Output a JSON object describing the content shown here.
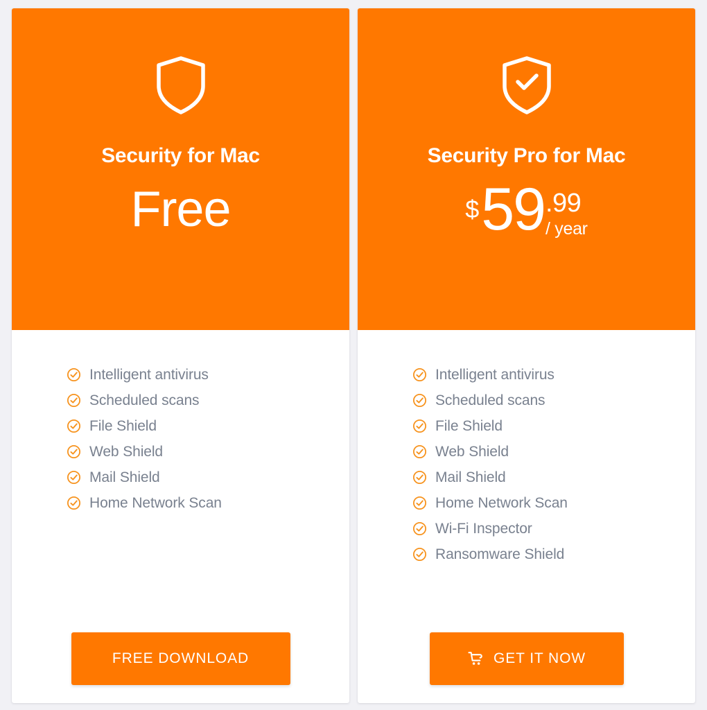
{
  "theme": {
    "accent": "#ff7800",
    "page_background": "#f1f1f5",
    "card_background": "#ffffff",
    "feature_text_color": "#79818f",
    "header_text_color": "#ffffff"
  },
  "cards": [
    {
      "id": "security-for-mac",
      "icon": "shield-icon",
      "title": "Security for Mac",
      "price": {
        "type": "free",
        "free_label": "Free",
        "currency": "",
        "amount": "",
        "cents": "",
        "period": ""
      },
      "features": [
        "Intelligent antivirus",
        "Scheduled scans",
        "File Shield",
        "Web Shield",
        "Mail Shield",
        "Home Network Scan"
      ],
      "cta": {
        "label": "FREE DOWNLOAD",
        "icon": ""
      }
    },
    {
      "id": "security-pro-for-mac",
      "icon": "shield-check-icon",
      "title": "Security Pro for Mac",
      "price": {
        "type": "paid",
        "free_label": "",
        "currency": "$",
        "amount": "59",
        "cents": ".99",
        "period": "/ year"
      },
      "features": [
        "Intelligent antivirus",
        "Scheduled scans",
        "File Shield",
        "Web Shield",
        "Mail Shield",
        "Home Network Scan",
        "Wi-Fi Inspector",
        "Ransomware Shield"
      ],
      "cta": {
        "label": "GET IT NOW",
        "icon": "shopping-cart-icon"
      }
    }
  ]
}
